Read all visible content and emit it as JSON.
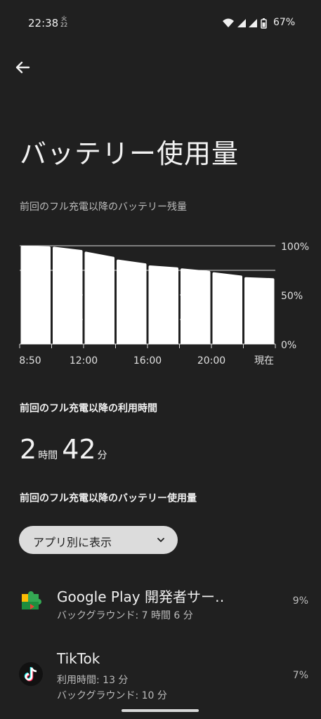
{
  "status_bar": {
    "time": "22:38",
    "day_kanji": "火",
    "day_num": "22",
    "battery_percent": "67%",
    "icons": [
      "wifi-icon",
      "signal-icon",
      "signal-icon",
      "battery-icon"
    ]
  },
  "header": {
    "back_icon": "arrow-left-icon",
    "title": "バッテリー使用量",
    "subtitle": "前回のフル充電以降のバッテリー残量"
  },
  "chart_data": {
    "type": "bar",
    "categories": [
      "1",
      "2",
      "3",
      "4",
      "5",
      "6",
      "7",
      "8"
    ],
    "values": [
      100,
      99,
      94,
      86,
      80,
      77,
      73,
      68
    ],
    "x_tick_labels": [
      "8:50",
      "12:00",
      "16:00",
      "20:00",
      "現在"
    ],
    "y_tick_labels": [
      "100%",
      "50%",
      "0%"
    ],
    "ylim": [
      0,
      100
    ],
    "grid": true,
    "colors": {
      "bar": "#ffffff",
      "grid": "#dddddd",
      "text": "#e0e0e0"
    }
  },
  "usage_time": {
    "label": "前回のフル充電以降の利用時間",
    "hours": "2",
    "hours_unit": "時間",
    "minutes": "42",
    "minutes_unit": "分"
  },
  "battery_usage": {
    "label": "前回のフル充電以降のバッテリー使用量",
    "dropdown_label": "アプリ別に表示",
    "dropdown_icon": "chevron-down-icon"
  },
  "apps": [
    {
      "name": "Google Play 開発者サー‥",
      "line1": "バックグラウンド: 7 時間 6 分",
      "line2": "",
      "percent": "9%",
      "icon": "google-play-services-icon"
    },
    {
      "name": "TikTok",
      "line1": "利用時間: 13 分",
      "line2": "バックグラウンド: 10 分",
      "percent": "7%",
      "icon": "tiktok-icon"
    }
  ]
}
